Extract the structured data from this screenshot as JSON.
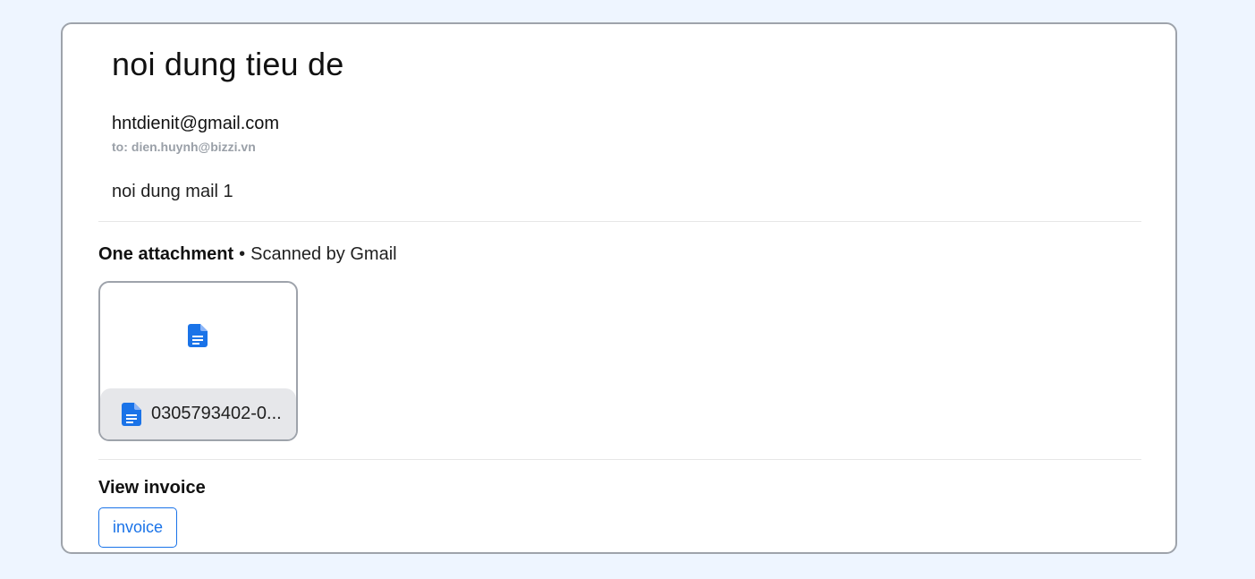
{
  "email": {
    "subject": "noi dung tieu de",
    "sender": "hntdienit@gmail.com",
    "recipient_prefix": "to:",
    "recipient": "dien.huynh@bizzi.vn",
    "body": "noi dung mail 1"
  },
  "attachments": {
    "count_label": "One attachment",
    "separator": "•",
    "scan_label": "Scanned by Gmail",
    "items": [
      {
        "file_name": "0305793402-0...",
        "icon": "document-icon"
      }
    ]
  },
  "invoice": {
    "section_title": "View invoice",
    "button_label": "invoice"
  },
  "colors": {
    "page_background": "#eef5ff",
    "accent": "#1a73e8",
    "card_border": "#9ea3ab",
    "file_footer": "#e6e7ea"
  }
}
